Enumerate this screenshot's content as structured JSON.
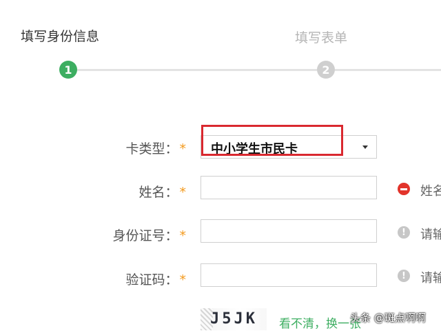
{
  "steps": [
    {
      "number": "1",
      "title": "填写身份信息"
    },
    {
      "number": "2",
      "title": "填写表单"
    }
  ],
  "form": {
    "required_mark": "*",
    "card_type": {
      "label": "卡类型：",
      "value": "中小学生市民卡"
    },
    "name": {
      "label": "姓名：",
      "value": "",
      "hint": "姓名"
    },
    "id_number": {
      "label": "身份证号：",
      "value": "",
      "hint": "请输"
    },
    "captcha": {
      "label": "验证码：",
      "value": "",
      "hint": "请输",
      "image_text": "J5JK",
      "refresh_text": "看不清，换一张"
    }
  },
  "watermark": "头条 @斑点啊啊",
  "colors": {
    "accent_green": "#3dae61",
    "required_orange": "#f39a1d",
    "error_red": "#e2342b",
    "highlight_red": "#d9282f"
  }
}
